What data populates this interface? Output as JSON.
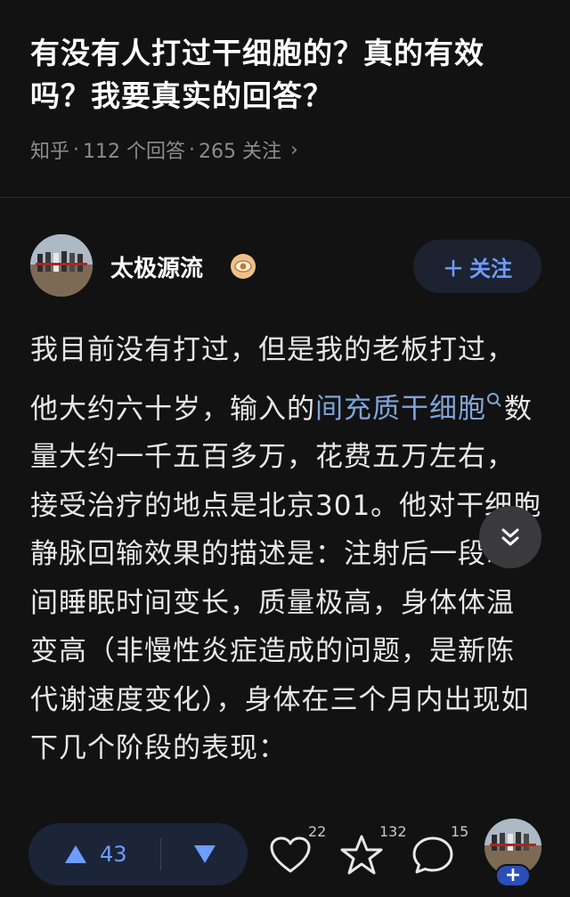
{
  "question": {
    "title": "有没有人打过干细胞的？真的有效吗？我要真实的回答？",
    "source": "知乎",
    "answers": "112 个回答",
    "followers": "265 关注"
  },
  "author": {
    "name": "太极源流",
    "badge_icon": "eye-icon",
    "follow_label": "关注"
  },
  "answer": {
    "text_before_link": "我目前没有打过，但是我的老板打过，他大约六十岁，输入的",
    "link_text": "间充质干细胞",
    "text_after_link": "数量大约一千五百多万，花费五万左右，接受治疗的地点是北京301。他对干细胞静脉回输效果的描述是：注射后一段时间睡眠时间变长，质量极高，身体体温变高（非慢性炎症造成的问题，是新陈代谢速度变化），身体在三个月内出现如下几个阶段的表现："
  },
  "actions": {
    "upvotes": "43",
    "likes": "22",
    "favorites": "132",
    "comments": "15"
  },
  "colors": {
    "background": "#121212",
    "accent": "#6e9cff",
    "link": "#7fa4d8"
  }
}
